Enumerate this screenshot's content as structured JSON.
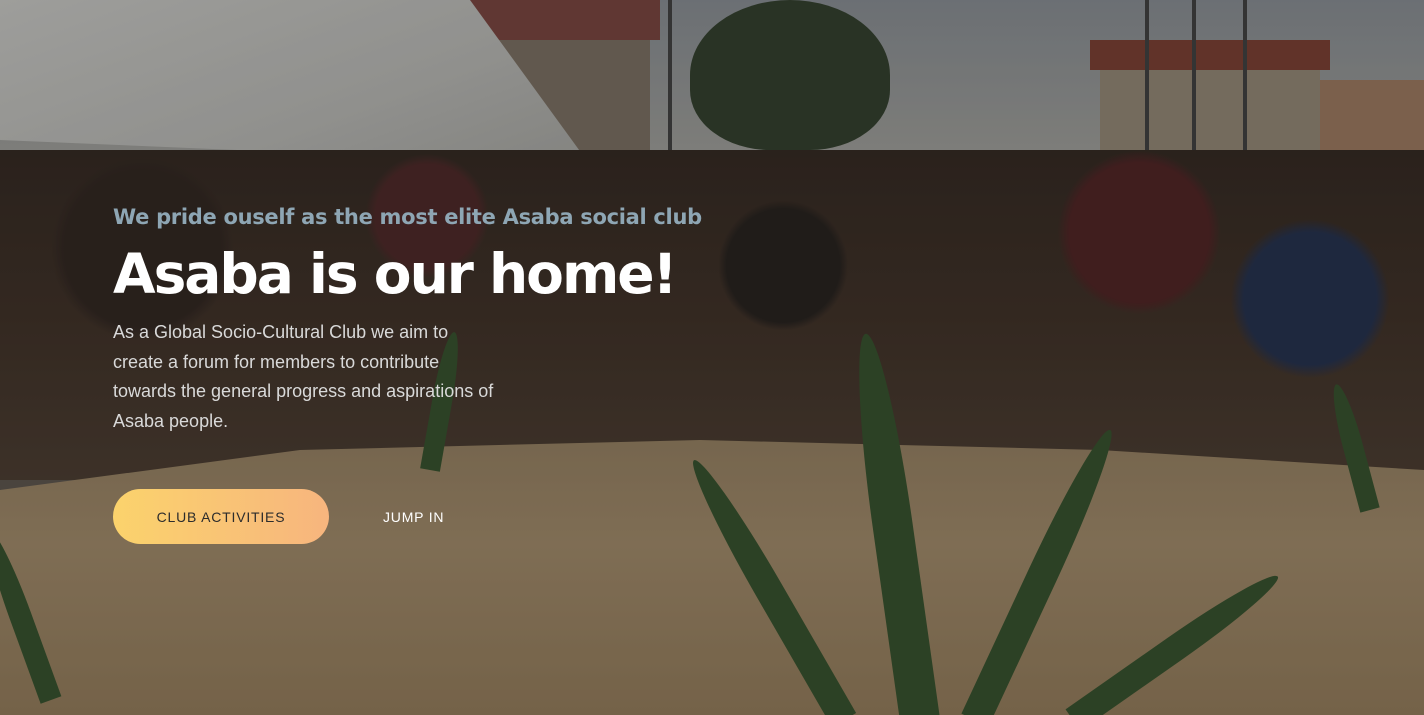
{
  "hero": {
    "tagline": "We pride ouself as the most elite Asaba social club",
    "headline": "Asaba is our home!",
    "description": "As a Global Socio-Cultural Club we aim to create a forum for members to contribute towards the general progress and aspirations of Asaba people.",
    "primary_button": "CLUB ACTIVITIES",
    "secondary_button": "JUMP IN"
  },
  "colors": {
    "tagline": "#8ea6b4",
    "headline": "#ffffff",
    "button_gradient_start": "#fbd36c",
    "button_gradient_end": "#f7b57e"
  }
}
